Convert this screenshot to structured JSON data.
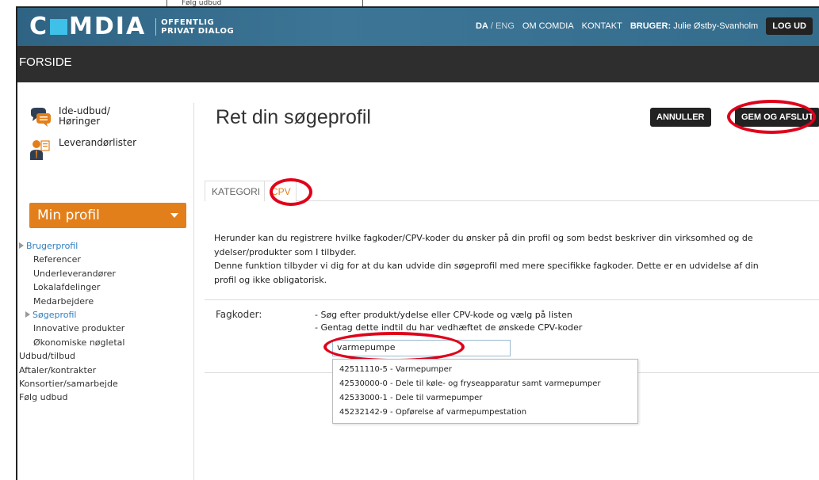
{
  "background_tab": {
    "label": "Følg udbud"
  },
  "header": {
    "logo_text": "COMDIA",
    "logo_sub_line1": "OFFENTLIG",
    "logo_sub_line2": "PRIVAT DIALOG",
    "lang_active": "DA",
    "lang_sep": " / ",
    "lang_other": "ENG",
    "om_comdia": "OM COMDIA",
    "kontakt": "KONTAKT",
    "user_label": "BRUGER:",
    "user_name": "Julie Østby-Svanholm",
    "logout": "LOG UD",
    "colors": {
      "topbar": "#346c8c",
      "logo_accent": "#3ec0e8",
      "menubar": "#2e2e2e"
    }
  },
  "menubar": {
    "home": "FORSIDE"
  },
  "sidebar": {
    "quick_links": [
      {
        "label_line1": "Ide-udbud/",
        "label_line2": "Høringer",
        "icon": "chat-bubbles-icon"
      },
      {
        "label_line1": "Leverandørlister",
        "label_line2": "",
        "icon": "person-list-icon"
      }
    ],
    "min_profil": "Min profil",
    "menu": [
      {
        "label": "Brugerprofil",
        "level": 1,
        "active": true,
        "arrow": true
      },
      {
        "label": "Referencer",
        "level": 2
      },
      {
        "label": "Underleverandører",
        "level": 2
      },
      {
        "label": "Lokalafdelinger",
        "level": 2
      },
      {
        "label": "Medarbejdere",
        "level": 2
      },
      {
        "label": "Søgeprofil",
        "level": 2,
        "active": true,
        "arrow": true
      },
      {
        "label": "Innovative produkter",
        "level": 2
      },
      {
        "label": "Økonomiske nøgletal",
        "level": 2
      },
      {
        "label": "Udbud/tilbud",
        "level": 1
      },
      {
        "label": "Aftaler/kontrakter",
        "level": 1
      },
      {
        "label": "Konsortier/samarbejde",
        "level": 1
      },
      {
        "label": "Følg udbud",
        "level": 1
      }
    ],
    "accent_color": "#e37f1a"
  },
  "main": {
    "title": "Ret din søgeprofil",
    "cancel_button": "ANNULLER",
    "save_button": "GEM OG AFSLUT",
    "tabs": [
      {
        "label": "KATEGORI",
        "active": false
      },
      {
        "label": "CPV",
        "active": true
      }
    ],
    "desc_line1": "Herunder kan du registrere hvilke fagkoder/CPV-koder du ønsker på din profil og som bedst beskriver din virksomhed og de",
    "desc_line2": "ydelser/produkter som I tilbyder.",
    "desc_line3": "Denne funktion tilbyder vi dig for at du kan udvide din søgeprofil med mere specifikke fagkoder. Dette er en udvidelse af din",
    "desc_line4": "profil og ikke obligatorisk.",
    "fagkoder_label": "Fagkoder:",
    "instruction1": "- Søg efter produkt/ydelse eller CPV-kode og vælg på listen",
    "instruction2": "- Gentag dette indtil du har vedhæftet de ønskede CPV-koder",
    "search_value": "varmepumpe",
    "suggestions": [
      "42511110-5 - Varmepumper",
      "42530000-0 - Dele til køle- og fryseapparatur samt varmepumper",
      "42533000-1 - Dele til varmepumper",
      "45232142-9 - Opførelse af varmepumpestation"
    ],
    "highlight_color": "#e0001a"
  }
}
